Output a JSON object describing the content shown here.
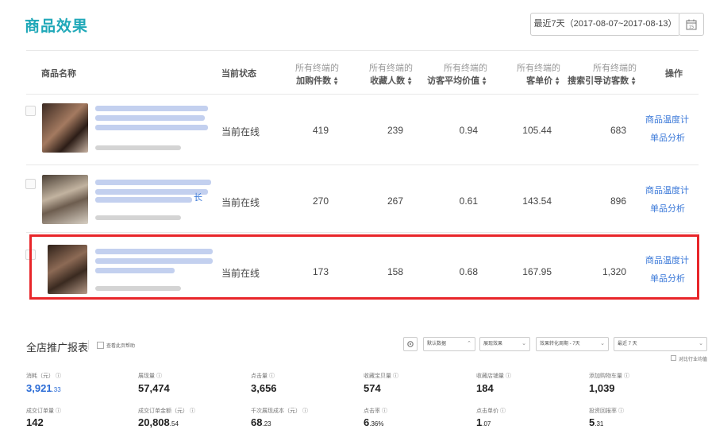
{
  "header": {
    "title": "商品效果",
    "date_range": "最近7天（2017-08-07~2017-08-13）"
  },
  "table": {
    "columns": [
      {
        "main": "商品名称"
      },
      {
        "main": "当前状态"
      },
      {
        "sub": "所有终端的",
        "main": "加购件数"
      },
      {
        "sub": "所有终端的",
        "main": "收藏人数"
      },
      {
        "sub": "所有终端的",
        "main": "访客平均价值"
      },
      {
        "sub": "所有终端的",
        "main": "客单价"
      },
      {
        "sub": "所有终端的",
        "main": "搜索引导访客数"
      },
      {
        "main": "操作"
      }
    ],
    "rows": [
      {
        "name_tail": "",
        "status": "当前在线",
        "cart": "419",
        "fav": "239",
        "avg": "0.94",
        "price": "105.44",
        "search": "683",
        "action1": "商品温度计",
        "action2": "单品分析"
      },
      {
        "name_tail": "长",
        "status": "当前在线",
        "cart": "270",
        "fav": "267",
        "avg": "0.61",
        "price": "143.54",
        "search": "896",
        "action1": "商品温度计",
        "action2": "单品分析"
      },
      {
        "name_tail": "",
        "status": "当前在线",
        "cart": "173",
        "fav": "158",
        "avg": "0.68",
        "price": "167.95",
        "search": "1,320",
        "action1": "商品温度计",
        "action2": "单品分析"
      }
    ]
  },
  "promo": {
    "title": "全店推广报表",
    "help_label": "查看此页帮助",
    "selects": [
      "默认数据",
      "展现效果",
      "效果转化周期 - 7天",
      "最近 7 天"
    ],
    "compare_label": "对比行业均值",
    "metrics_row1": [
      {
        "label": "消耗（元）",
        "value": "3,921",
        "decimal": ".33"
      },
      {
        "label": "展现量",
        "value": "57,474",
        "decimal": ""
      },
      {
        "label": "点击量",
        "value": "3,656",
        "decimal": ""
      },
      {
        "label": "收藏宝贝量",
        "value": "574",
        "decimal": ""
      },
      {
        "label": "收藏店铺量",
        "value": "184",
        "decimal": ""
      },
      {
        "label": "添加购物车量",
        "value": "1,039",
        "decimal": ""
      }
    ],
    "metrics_row2": [
      {
        "label": "成交订单量",
        "value": "142",
        "decimal": ""
      },
      {
        "label": "成交订单金额（元）",
        "value": "20,808",
        "decimal": ".54"
      },
      {
        "label": "千次展现成本（元）",
        "value": "68",
        "decimal": ".23"
      },
      {
        "label": "点击率",
        "value": "6",
        "decimal": ".36%"
      },
      {
        "label": "点击单价",
        "value": "1",
        "decimal": ".07"
      },
      {
        "label": "投资回报率",
        "value": "5",
        "decimal": ".31"
      }
    ]
  },
  "colors": {
    "accent": "#1fa8b8",
    "link": "#3a78d8",
    "highlight": "#e8262a",
    "metric_blue": "#2b6cd6"
  }
}
